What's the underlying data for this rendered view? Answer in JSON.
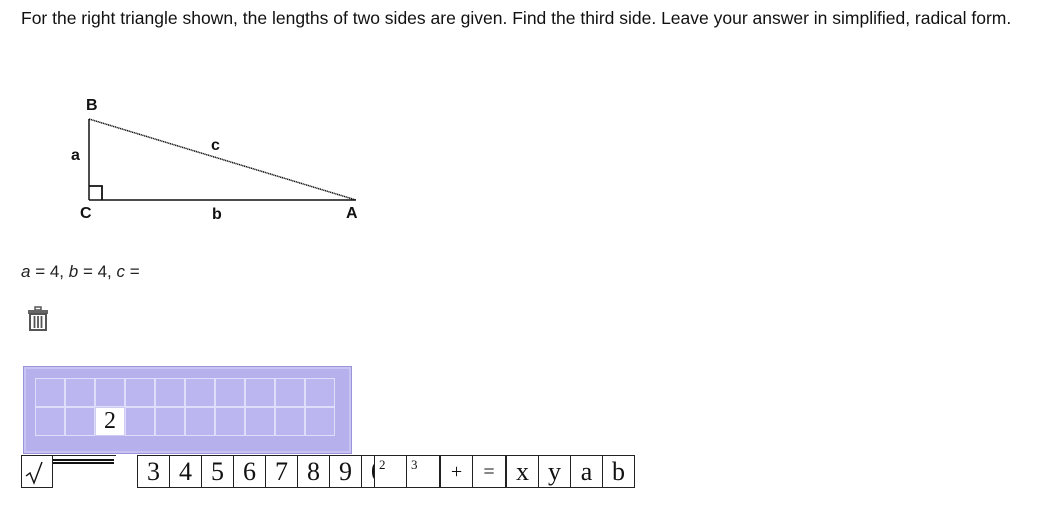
{
  "question": {
    "text": "For the right triangle shown, the lengths of two sides are given. Find the third side. Leave your answer in simplified, radical form."
  },
  "triangle": {
    "vertex_a": "A",
    "vertex_b": "B",
    "vertex_c": "C",
    "side_a": "a",
    "side_b": "b",
    "side_c": "c"
  },
  "equation": {
    "var_a": "a",
    "eq_a": " = 4, ",
    "var_b": "b",
    "eq_b": " = 4, ",
    "var_c": "c",
    "eq_c": " = "
  },
  "answer_input": {
    "current_value": "2",
    "active_cell_index": 12
  },
  "toolbar": {
    "digits": [
      "3",
      "4",
      "5",
      "6",
      "7",
      "8",
      "9",
      "0"
    ],
    "square_label": "2",
    "cube_label": "3",
    "plus_label": "+",
    "equals_label": "=",
    "variables": [
      "x",
      "y",
      "a",
      "b"
    ]
  },
  "colors": {
    "keypad_bg": "#b6b0ec",
    "cell_bg": "#bcb6f0"
  },
  "icons": {
    "trash": "trash-icon",
    "radical": "square-root-icon"
  }
}
